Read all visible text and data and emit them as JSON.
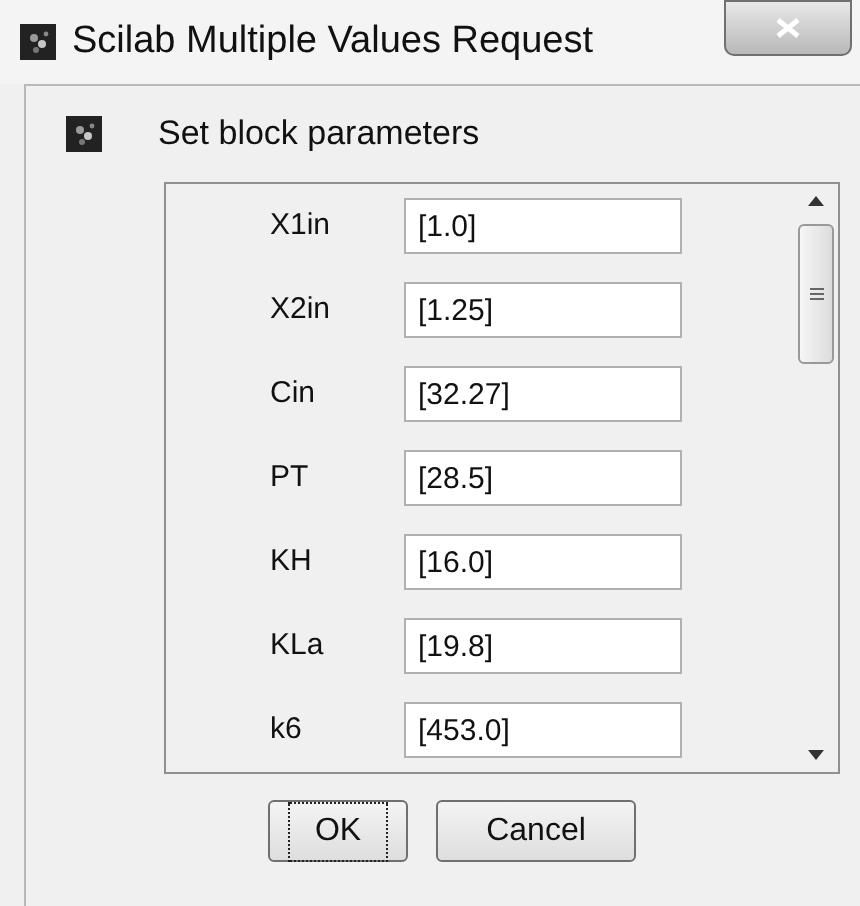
{
  "window": {
    "title": "Scilab Multiple Values Request"
  },
  "heading": "Set block parameters",
  "fields": [
    {
      "label": "X1in",
      "value": "[1.0]"
    },
    {
      "label": "X2in",
      "value": "[1.25]"
    },
    {
      "label": "Cin",
      "value": "[32.27]"
    },
    {
      "label": "PT",
      "value": "[28.5]"
    },
    {
      "label": "KH",
      "value": "[16.0]"
    },
    {
      "label": "KLa",
      "value": "[19.8]"
    },
    {
      "label": "k6",
      "value": "[453.0]"
    }
  ],
  "buttons": [
    {
      "label": "OK",
      "focused": true
    },
    {
      "label": "Cancel",
      "focused": false
    }
  ]
}
